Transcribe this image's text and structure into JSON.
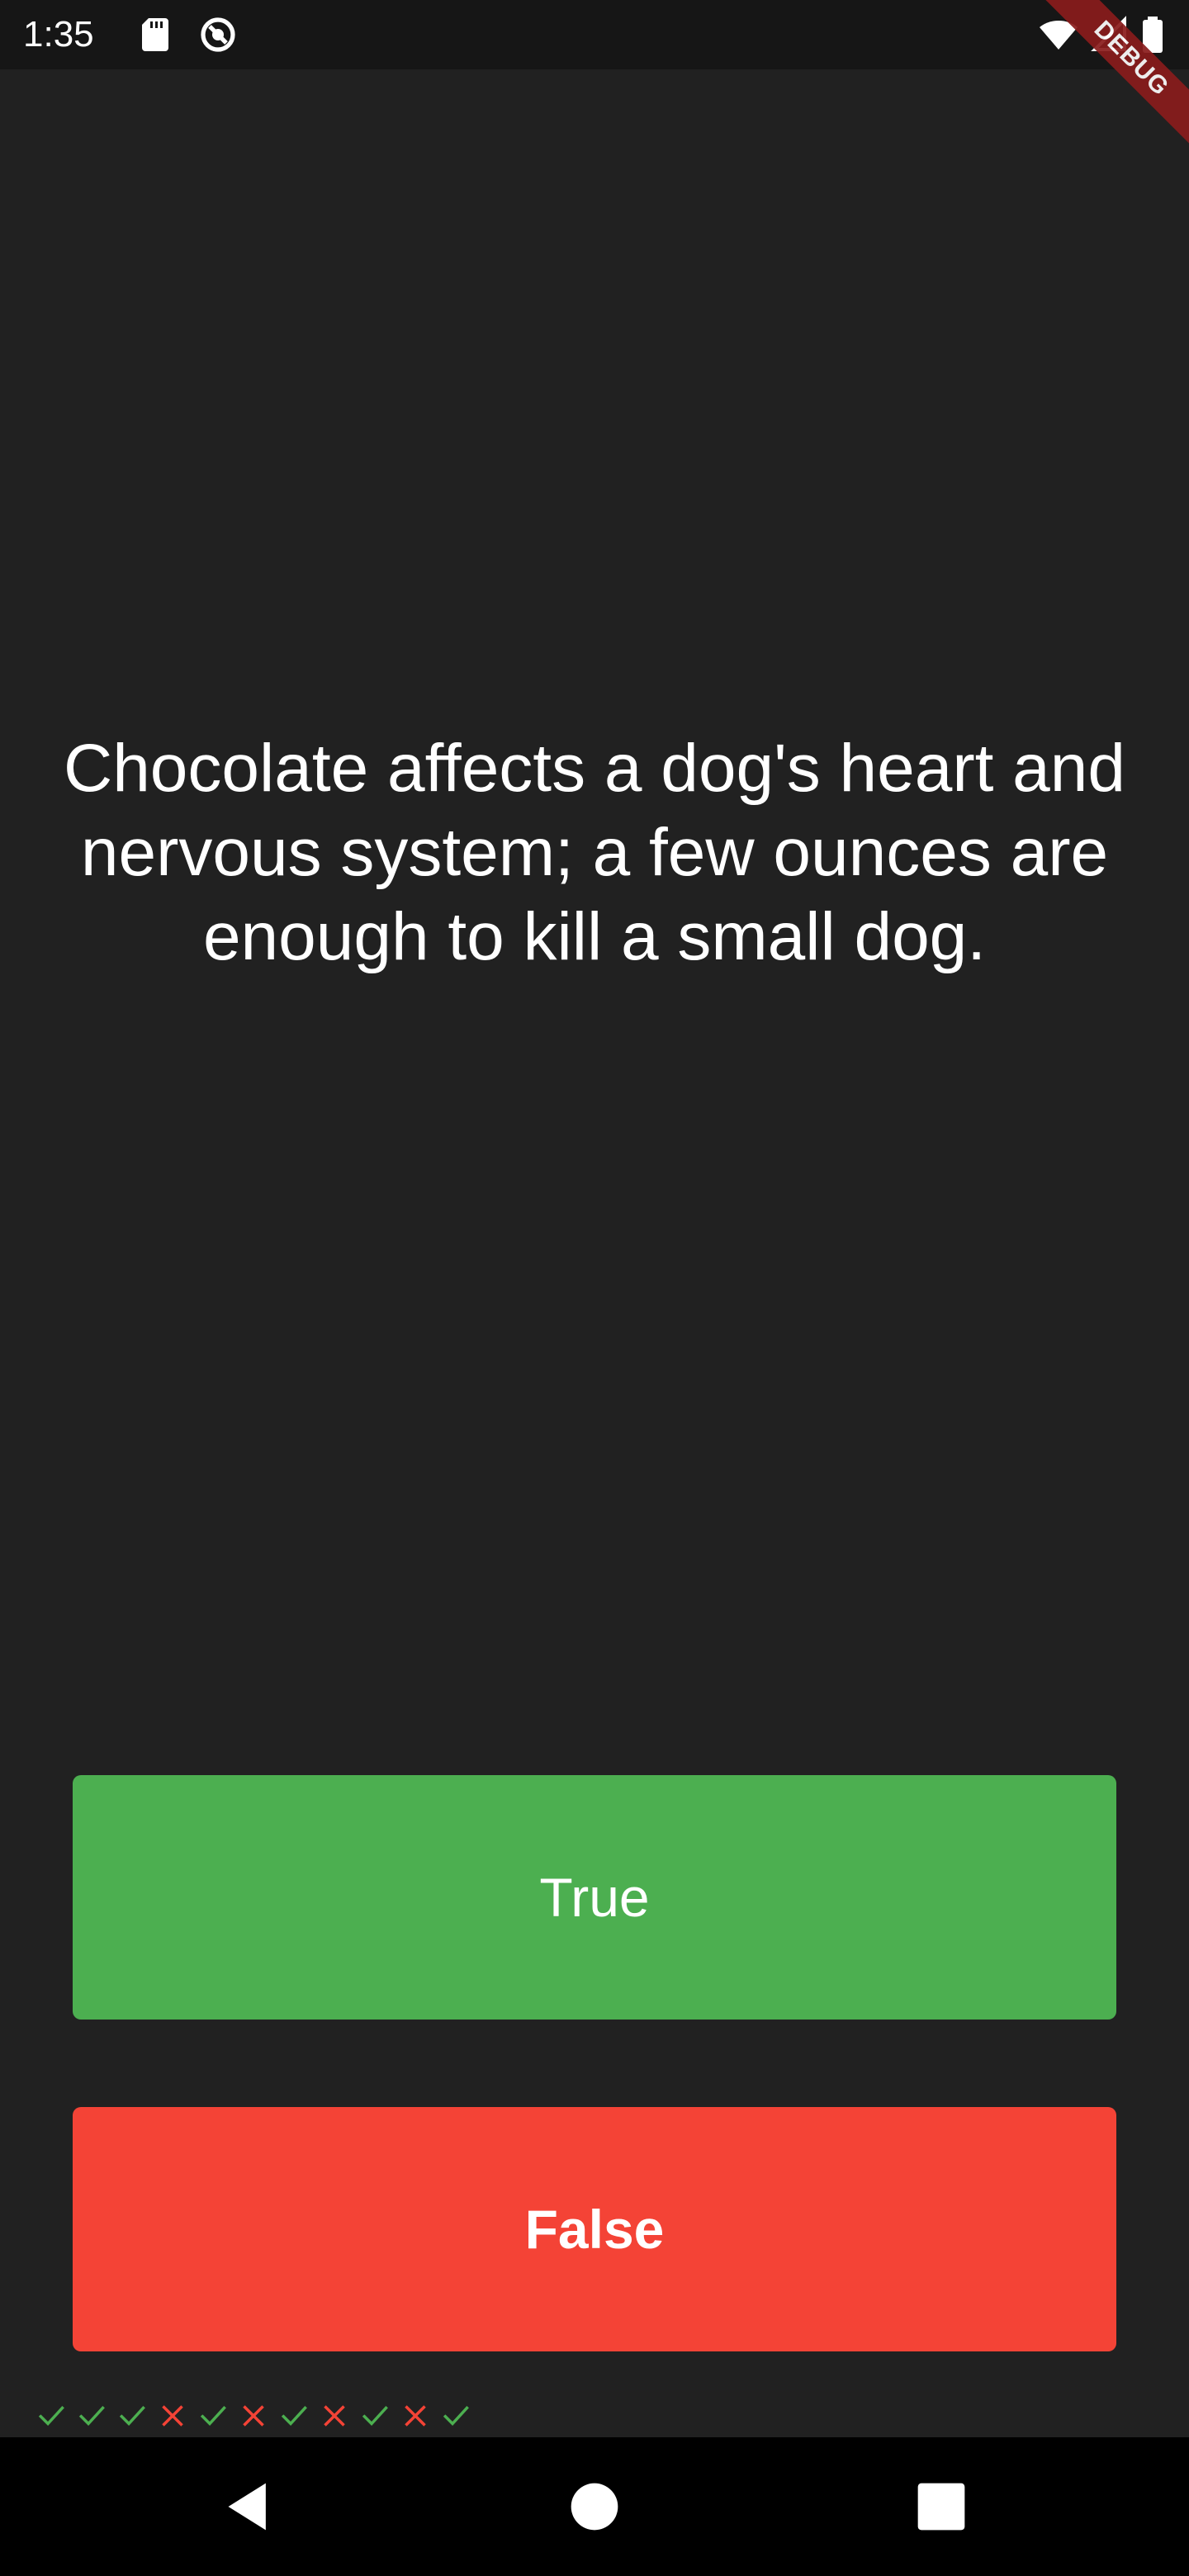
{
  "status_bar": {
    "time": "1:35",
    "icons": [
      "sd-card-icon",
      "sync-icon",
      "wifi-icon",
      "signal-icon",
      "battery-icon"
    ]
  },
  "debug_banner": {
    "label": "DEBUG",
    "color": "#8a1c1c"
  },
  "question": {
    "text": "Chocolate affects a dog's heart and nervous system; a few ounces are enough to kill a small dog."
  },
  "buttons": {
    "true_label": "True",
    "false_label": "False",
    "true_color": "#4caf50",
    "false_color": "#f44336"
  },
  "score_keeper": {
    "marks": [
      "check",
      "check",
      "check",
      "cross",
      "check",
      "cross",
      "check",
      "cross",
      "check",
      "cross",
      "check"
    ],
    "check_color": "#4caf50",
    "cross_color": "#f44336"
  },
  "nav_bar": {
    "icons": [
      "back-icon",
      "home-icon",
      "recents-icon"
    ]
  }
}
